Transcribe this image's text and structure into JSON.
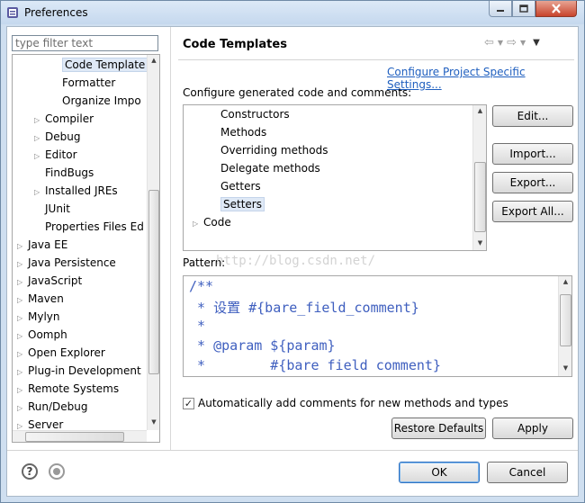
{
  "window": {
    "title": "Preferences"
  },
  "sidebar": {
    "filter_placeholder": "type filter text",
    "items": [
      {
        "label": "Code Template",
        "indent": 3,
        "expandable": false,
        "selected": true
      },
      {
        "label": "Formatter",
        "indent": 3,
        "expandable": false
      },
      {
        "label": "Organize Impo",
        "indent": 3,
        "expandable": false
      },
      {
        "label": "Compiler",
        "indent": 2,
        "expandable": true
      },
      {
        "label": "Debug",
        "indent": 2,
        "expandable": true
      },
      {
        "label": "Editor",
        "indent": 2,
        "expandable": true
      },
      {
        "label": "FindBugs",
        "indent": 2,
        "expandable": false
      },
      {
        "label": "Installed JREs",
        "indent": 2,
        "expandable": true
      },
      {
        "label": "JUnit",
        "indent": 2,
        "expandable": false
      },
      {
        "label": "Properties Files Ed",
        "indent": 2,
        "expandable": false
      },
      {
        "label": "Java EE",
        "indent": 1,
        "expandable": true
      },
      {
        "label": "Java Persistence",
        "indent": 1,
        "expandable": true
      },
      {
        "label": "JavaScript",
        "indent": 1,
        "expandable": true
      },
      {
        "label": "Maven",
        "indent": 1,
        "expandable": true
      },
      {
        "label": "Mylyn",
        "indent": 1,
        "expandable": true
      },
      {
        "label": "Oomph",
        "indent": 1,
        "expandable": true
      },
      {
        "label": "Open Explorer",
        "indent": 1,
        "expandable": true
      },
      {
        "label": "Plug-in Development",
        "indent": 1,
        "expandable": true
      },
      {
        "label": "Remote Systems",
        "indent": 1,
        "expandable": true
      },
      {
        "label": "Run/Debug",
        "indent": 1,
        "expandable": true
      },
      {
        "label": "Server",
        "indent": 1,
        "expandable": true
      }
    ]
  },
  "main": {
    "title": "Code Templates",
    "configure_link": "Configure Project Specific Settings...",
    "configure_label": "Configure generated code and comments:",
    "templates": [
      {
        "label": "Constructors",
        "indent": 2,
        "expandable": false
      },
      {
        "label": "Methods",
        "indent": 2,
        "expandable": false
      },
      {
        "label": "Overriding methods",
        "indent": 2,
        "expandable": false
      },
      {
        "label": "Delegate methods",
        "indent": 2,
        "expandable": false
      },
      {
        "label": "Getters",
        "indent": 2,
        "expandable": false
      },
      {
        "label": "Setters",
        "indent": 2,
        "expandable": false,
        "selected": true
      },
      {
        "label": "Code",
        "indent": 1,
        "expandable": true
      }
    ],
    "buttons": {
      "edit": "Edit...",
      "import": "Import...",
      "export": "Export...",
      "export_all": "Export All..."
    },
    "pattern_label": "Pattern:",
    "watermark": "http://blog.csdn.net/",
    "pattern_lines": [
      "/**",
      " * 设置 #{bare_field_comment}",
      " *",
      " * @param ${param}",
      " *        #{bare field comment}"
    ],
    "auto_comment_label": "Automatically add comments for new methods and types",
    "auto_comment_checked": true,
    "restore_defaults": "Restore Defaults",
    "apply": "Apply"
  },
  "footer": {
    "ok": "OK",
    "cancel": "Cancel"
  },
  "colors": {
    "title_bar": "#c5d8ee",
    "link": "#1f5fbf",
    "code_comment": "#3f5fbf",
    "selection": "#dfe9f6"
  },
  "icons": [
    "app-icon",
    "minimize-icon",
    "maximize-icon",
    "close-icon",
    "back-icon",
    "forward-icon",
    "menu-icon",
    "help-icon",
    "stop-icon"
  ]
}
